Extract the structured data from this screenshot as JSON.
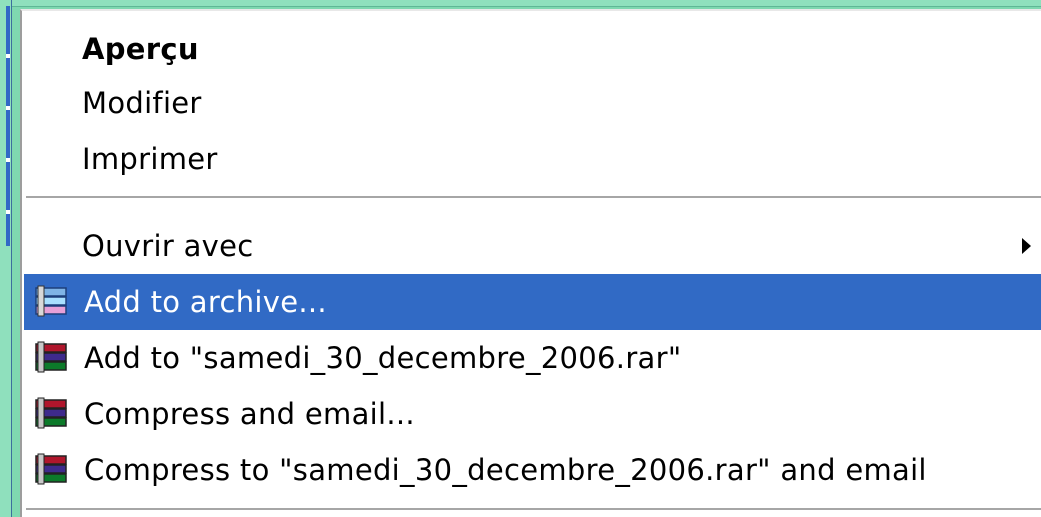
{
  "menu": {
    "items": [
      {
        "label": "Aperçu"
      },
      {
        "label": "Modifier"
      },
      {
        "label": "Imprimer"
      },
      {
        "label": "Ouvrir avec"
      },
      {
        "label": "Add to archive..."
      },
      {
        "label": "Add to \"samedi_30_decembre_2006.rar\""
      },
      {
        "label": "Compress and email..."
      },
      {
        "label": "Compress to \"samedi_30_decembre_2006.rar\" and email"
      }
    ]
  },
  "colors": {
    "highlight": "#316ac5",
    "frame": "#8fe0bd"
  },
  "icons": {
    "archive": "winrar-archive-icon",
    "submenu": "submenu-arrow-icon"
  }
}
